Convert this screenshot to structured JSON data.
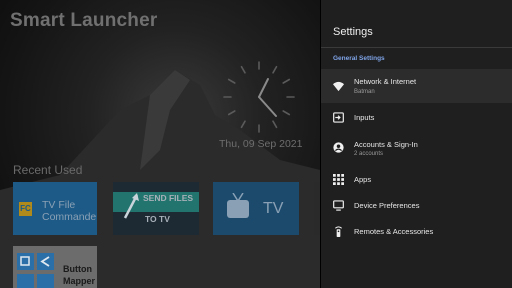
{
  "launcher": {
    "title": "Smart Launcher",
    "date": "Thu, 09 Sep 2021",
    "recent_label": "Recent Used",
    "tiles": {
      "tv_file": {
        "line1": "TV File",
        "line2": "Commander",
        "icon": "FC"
      },
      "send_files": {
        "line1": "SEND FILES",
        "line2": "TO TV"
      },
      "tv": {
        "label": "TV"
      },
      "button_mapper": {
        "line1": "Button",
        "line2": "Mapper"
      }
    }
  },
  "settings": {
    "title": "Settings",
    "section": "General Settings",
    "items": [
      {
        "label": "Network & Internet",
        "sub": "Batman",
        "icon": "wifi-icon",
        "selected": true
      },
      {
        "label": "Inputs",
        "sub": "",
        "icon": "input-icon"
      },
      {
        "label": "Accounts & Sign-In",
        "sub": "2 accounts",
        "icon": "account-icon"
      },
      {
        "label": "Apps",
        "sub": "",
        "icon": "apps-grid-icon"
      },
      {
        "label": "Device Preferences",
        "sub": "",
        "icon": "monitor-icon"
      },
      {
        "label": "Remotes & Accessories",
        "sub": "",
        "icon": "remote-icon"
      }
    ]
  },
  "colors": {
    "panel_bg": "#1f1f1f",
    "accent": "#7fa4e8",
    "selected_bg": "#2c2c2c"
  }
}
